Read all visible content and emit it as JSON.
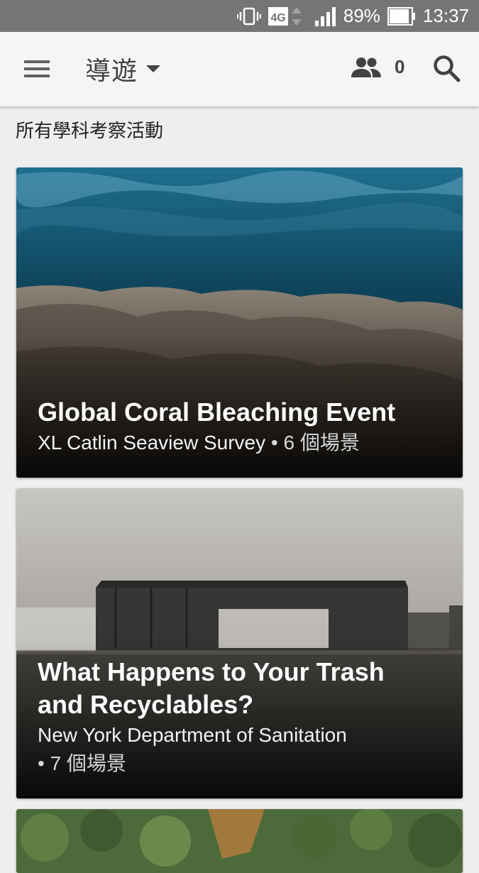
{
  "status_bar": {
    "network": "4G",
    "battery": "89%",
    "time": "13:37",
    "icons": [
      "vibrate-icon",
      "network-4g-icon",
      "signal-icon",
      "battery-icon"
    ]
  },
  "app_bar": {
    "title": "導遊",
    "participants_count": "0",
    "icons": [
      "menu-icon",
      "dropdown-caret-icon",
      "people-icon",
      "search-icon"
    ]
  },
  "section": {
    "title": "所有學科考察活動"
  },
  "cards": [
    {
      "title": "Global Coral Bleaching Event",
      "source": "XL Catlin Seaview Survey",
      "scenes": "• 6 個場景"
    },
    {
      "title_line1": "What Happens to Your Trash",
      "title_line2": "and Recyclables?",
      "source": "New York Department of Sanitation",
      "scenes": "• 7 個場景"
    },
    {
      "title": ""
    }
  ]
}
